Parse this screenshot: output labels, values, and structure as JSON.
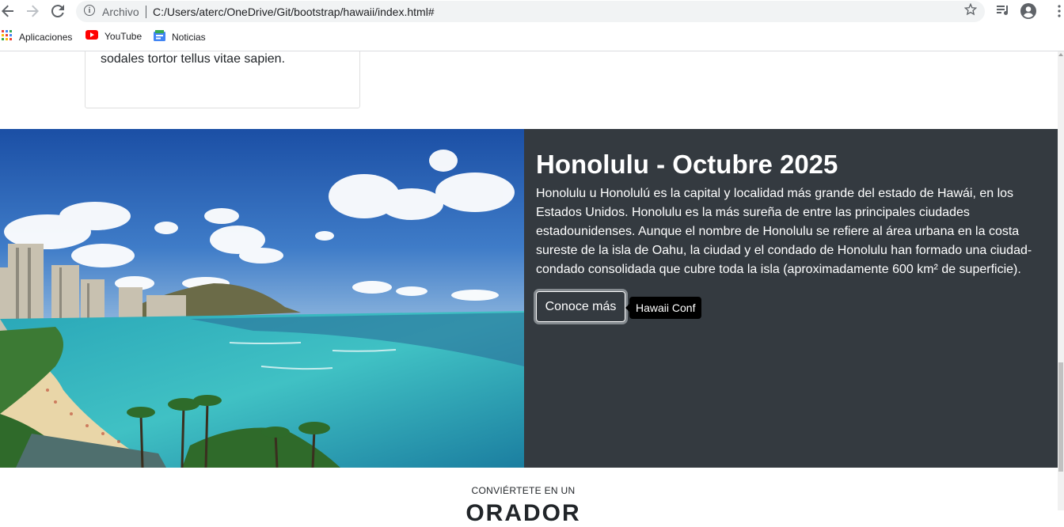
{
  "browser": {
    "omnibox_label": "Archivo",
    "url": "C:/Users/aterc/OneDrive/Git/bootstrap/hawaii/index.html#",
    "bookmarks": [
      {
        "label": "Aplicaciones",
        "icon": "apps-grid-icon"
      },
      {
        "label": "YouTube",
        "icon": "youtube-icon"
      },
      {
        "label": "Noticias",
        "icon": "news-icon"
      }
    ]
  },
  "card": {
    "text": "justo massa consequat tellus, suscipit sodales tortor tellus vitae sapien."
  },
  "hero": {
    "title": "Honolulu - Octubre 2025",
    "description": "Honolulu u Honolulú es la capital y localidad más grande del estado de Hawái, en los Estados Unidos. Honolulu es la más sureña de entre las principales ciudades estadounidenses. Aunque el nombre de Honolulu se refiere al área urbana en la costa sureste de la isla de Oahu, la ciudad y el condado de Honolulu han formado una ciudad-condado consolidada que cubre toda la isla (aproximadamente 600 km² de superficie).",
    "button_label": "Conoce más",
    "tooltip": "Hawaii Conf",
    "dark_bg": "#343a40"
  },
  "next_section": {
    "kicker": "CONVIÉRTETE EN UN",
    "title": "ORADOR"
  }
}
